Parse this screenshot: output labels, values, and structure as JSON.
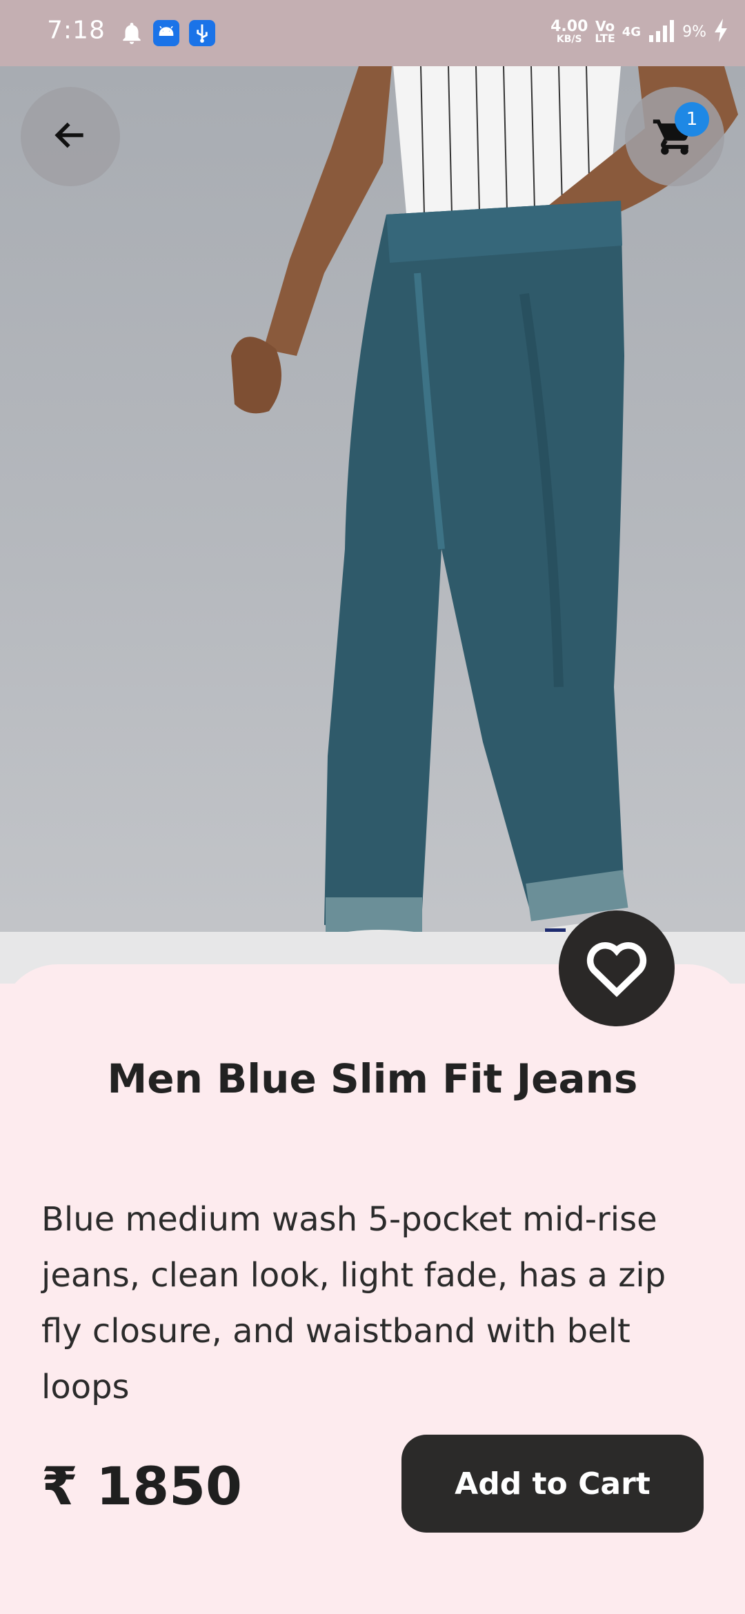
{
  "status_bar": {
    "time": "7:18",
    "speed_value": "4.00",
    "speed_unit": "KB/S",
    "volte_top": "Vo",
    "volte_bottom": "LTE",
    "network": "4G",
    "battery": "9%"
  },
  "header": {
    "back_icon": "arrow-left-icon",
    "cart_icon": "shopping-cart-icon",
    "cart_count": "1"
  },
  "product": {
    "title": "Men Blue Slim Fit Jeans",
    "description": "Blue medium wash 5-pocket mid-rise jeans, clean look, light fade, has a zip fly closure, and waistband with belt loops",
    "price": "₹ 1850",
    "add_to_cart_label": "Add to Cart",
    "favorite_icon": "heart-outline-icon"
  },
  "colors": {
    "status_bar": "#c4afb2",
    "sheet_background": "#fdebee",
    "button_dark": "#2b2a29",
    "badge_blue": "#1e88e5"
  }
}
